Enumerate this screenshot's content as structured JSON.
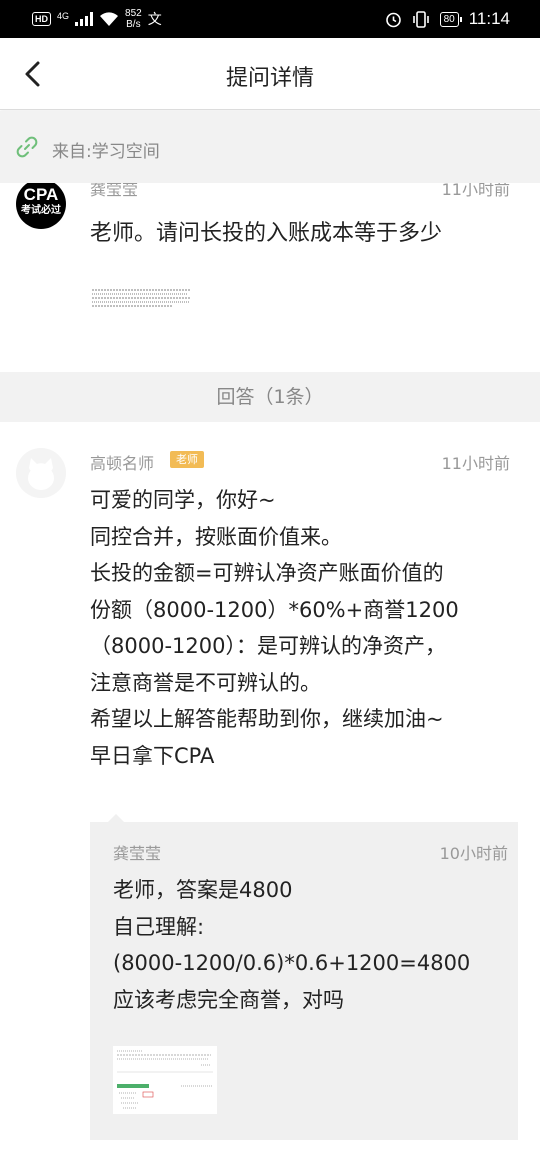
{
  "status_bar": {
    "hd_label": "HD",
    "network": "4G",
    "speed_value": "852",
    "speed_unit": "B/s",
    "battery": "80",
    "time": "11:14"
  },
  "nav": {
    "title": "提问详情"
  },
  "source": {
    "text": "来自:学习空间"
  },
  "question": {
    "avatar_top": "CPA",
    "avatar_bottom": "考试必过",
    "author": "龚莹莹",
    "time": "11小时前",
    "text": "老师。请问长投的入账成本等于多少"
  },
  "answers_header": "回答（1条）",
  "answer": {
    "author": "高顿名师",
    "badge": "老师",
    "time": "11小时前",
    "lines": [
      "可爱的同学，你好~",
      "同控合并，按账面价值来。",
      "长投的金额=可辨认净资产账面价值的",
      "份额（8000-1200）*60%+商誉1200",
      "（8000-1200）：是可辨认的净资产，",
      "注意商誉是不可辨认的。",
      "希望以上解答能帮助到你，继续加油~",
      "早日拿下CPA"
    ]
  },
  "reply": {
    "author": "龚莹莹",
    "time": "10小时前",
    "lines": [
      "老师，答案是4800",
      "自己理解:",
      "(8000-1200/0.6)*0.6+1200=4800",
      "应该考虑完全商誉，对吗"
    ]
  },
  "colors": {
    "badge": "#f2bb55",
    "link_icon": "#6fbf7a",
    "band": "#f2f2f2"
  }
}
